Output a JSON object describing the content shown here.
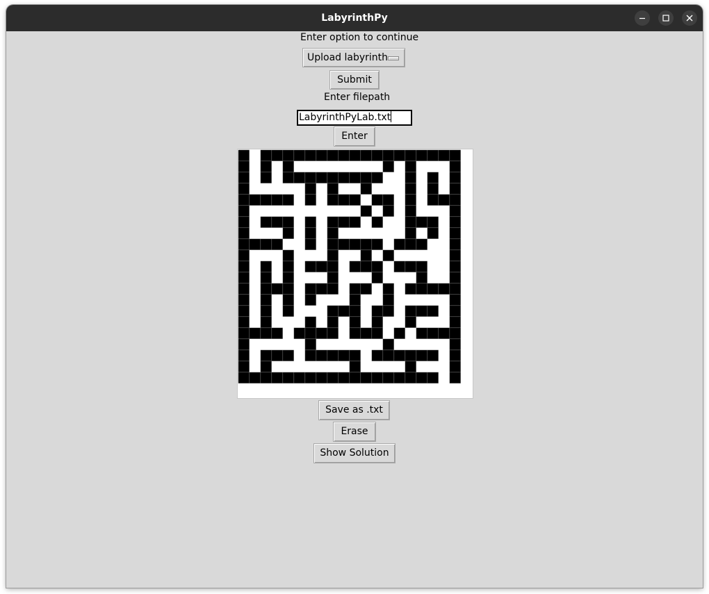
{
  "window": {
    "title": "LabyrinthPy"
  },
  "controls": {
    "option_prompt": "Enter option to continue",
    "option_selected": "Upload labyrinth",
    "submit_label": "Submit",
    "filepath_prompt": "Enter filepath",
    "filepath_value": "LabyrinthPyLab.txt",
    "enter_label": "Enter",
    "save_label": "Save as .txt",
    "erase_label": "Erase",
    "solution_label": "Show Solution"
  },
  "maze": {
    "wall_color": "#000000",
    "path_color": "#ffffff",
    "rows": [
      "10111111111111111111",
      "10101000000001010001",
      "10101111111110010101",
      "10000010100100010101",
      "11111010111011010111",
      "10000000000101010001",
      "10111010111010011101",
      "10001010100000010101",
      "11110010111110111001",
      "10001000100101000001",
      "10101011101110111001",
      "10101000100010001001",
      "10111011101101011111",
      "10101010001001000001",
      "10101000111011011101",
      "10100010101010010001",
      "11110111101110101111",
      "10000010000001000001",
      "10111011111011111101",
      "10100000001000010001",
      "11111111111111111101"
    ]
  }
}
